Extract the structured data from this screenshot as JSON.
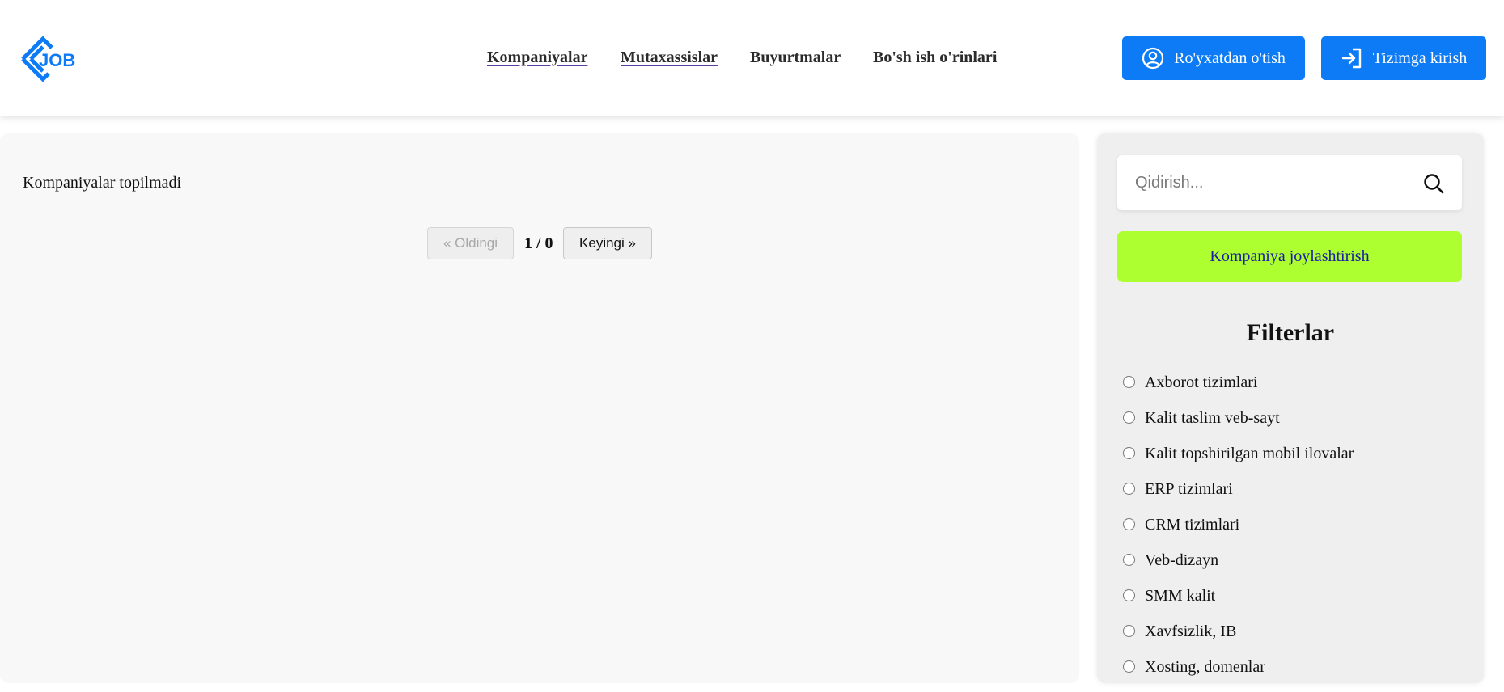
{
  "header": {
    "logo_text": "JOB",
    "nav": [
      {
        "label": "Kompaniyalar",
        "active": true
      },
      {
        "label": "Mutaxassislar",
        "active": true
      },
      {
        "label": "Buyurtmalar",
        "active": false
      },
      {
        "label": "Bo'sh ish o'rinlari",
        "active": false
      }
    ],
    "register_label": "Ro'yxatdan o'tish",
    "login_label": "Tizimga kirish"
  },
  "main": {
    "empty_message": "Kompaniyalar topilmadi",
    "pagination": {
      "prev_label": "« Oldingi",
      "page_indicator": "1 / 0",
      "next_label": "Keyingi »"
    }
  },
  "sidebar": {
    "search_placeholder": "Qidirish...",
    "post_company_label": "Kompaniya joylashtirish",
    "filters_title": "Filterlar",
    "filters": [
      "Axborot tizimlari",
      "Kalit taslim veb-sayt",
      "Kalit topshirilgan mobil ilovalar",
      "ERP tizimlari",
      "CRM tizimlari",
      "Veb-dizayn",
      "SMM kalit",
      "Xavfsizlik, IB",
      "Xosting, domenlar"
    ]
  },
  "colors": {
    "primary": "#0d7bf5",
    "accent_green": "#adff2f",
    "panel_bg": "#f8f8f8",
    "sidebar_bg": "#efefef"
  }
}
